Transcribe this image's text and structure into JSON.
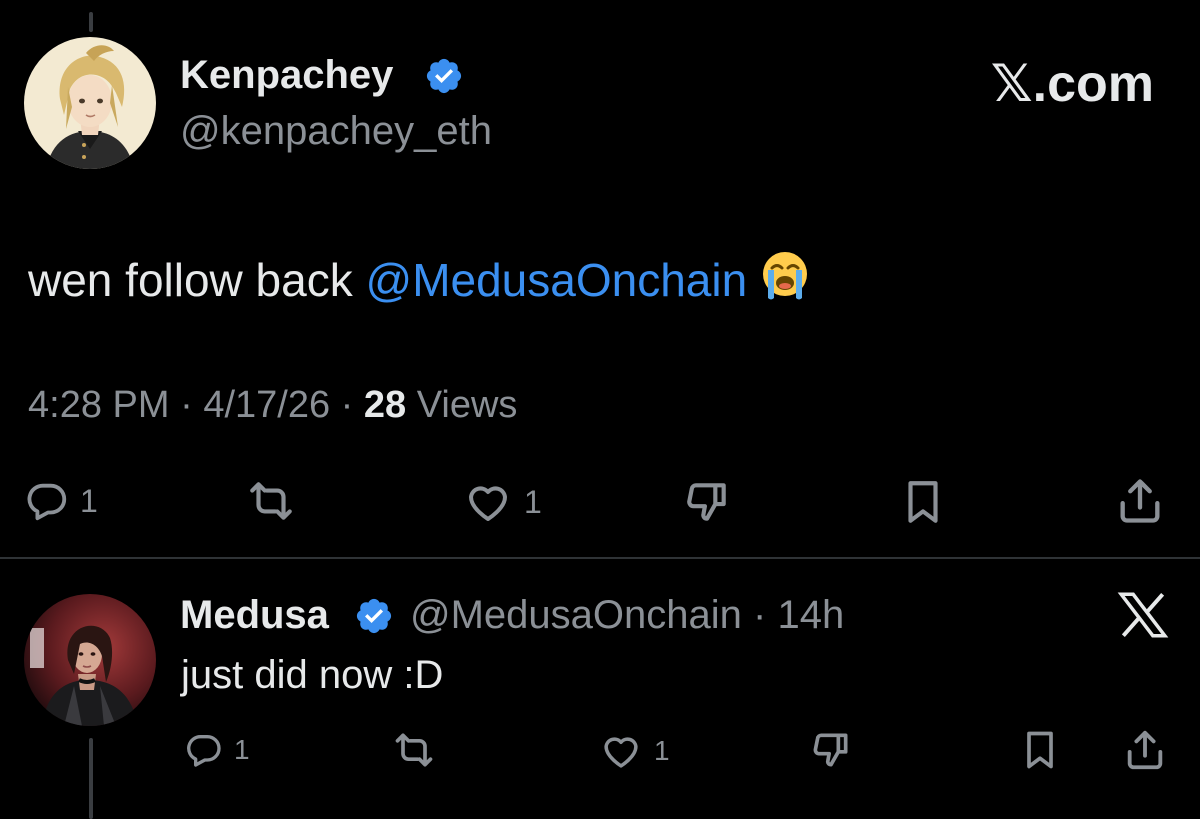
{
  "tweet": {
    "author": {
      "display_name": "Kenpachey",
      "handle": "@kenpachey_eth",
      "verified": true
    },
    "brand": "𝕏.com",
    "text_prefix": "wen follow back ",
    "mention": "@MedusaOnchain",
    "emoji": "loudly-crying-face",
    "time": "4:28 PM",
    "date": "4/17/26",
    "views_count": "28",
    "views_label": "Views",
    "actions": {
      "reply_count": "1",
      "repost_count": "",
      "like_count": "1"
    }
  },
  "reply": {
    "author": {
      "display_name": "Medusa",
      "handle": "@MedusaOnchain",
      "verified": true
    },
    "age": "14h",
    "text": "just did now :D",
    "actions": {
      "reply_count": "1",
      "repost_count": "",
      "like_count": "1"
    }
  },
  "colors": {
    "background": "#000000",
    "text": "#e7e9ea",
    "secondary": "#8b9096",
    "accent": "#3b8ff0",
    "verified": "#3b8ff0",
    "divider": "#2f3336"
  }
}
